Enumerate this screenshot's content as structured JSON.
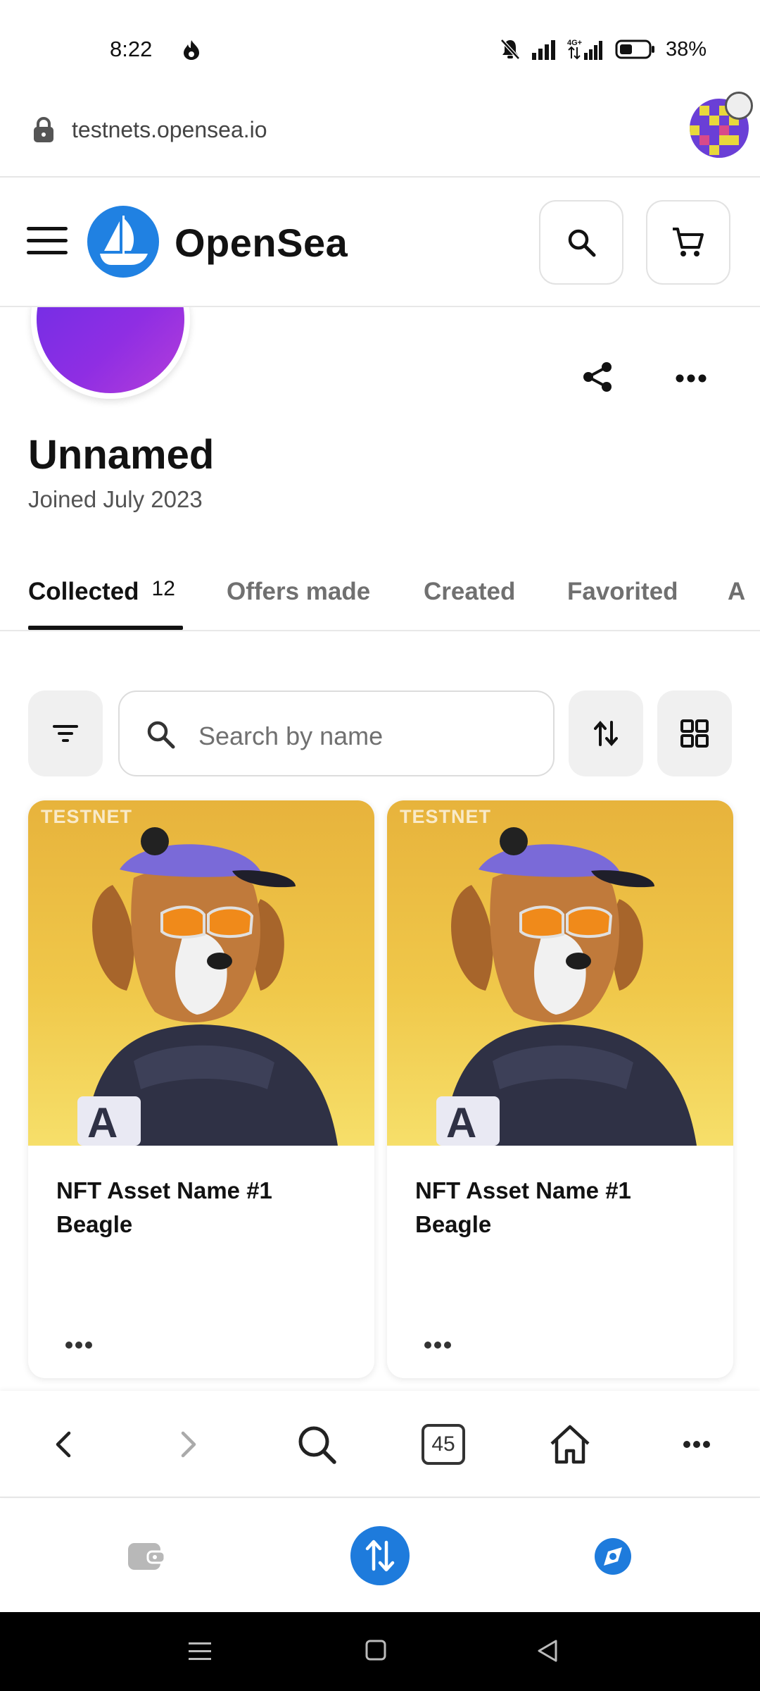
{
  "status_bar": {
    "time": "8:22",
    "battery": "38%"
  },
  "browser": {
    "url": "testnets.opensea.io",
    "tab_count": "45"
  },
  "header": {
    "brand": "OpenSea"
  },
  "profile": {
    "name": "Unnamed",
    "joined": "Joined July 2023"
  },
  "tabs": [
    {
      "label": "Collected",
      "count": "12"
    },
    {
      "label": "Offers made"
    },
    {
      "label": "Created"
    },
    {
      "label": "Favorited"
    },
    {
      "label": "A"
    }
  ],
  "search": {
    "placeholder": "Search by name"
  },
  "cards": [
    {
      "badge": "TESTNET",
      "name": "NFT Asset Name #1 Beagle"
    },
    {
      "badge": "TESTNET",
      "name": "NFT Asset Name #1 Beagle"
    }
  ],
  "icons": {
    "status": [
      "flame-icon",
      "mute-icon",
      "signal-icon",
      "4g-signal-icon",
      "battery-icon"
    ],
    "header": [
      "menu-icon",
      "opensea-logo-icon",
      "search-icon",
      "cart-icon"
    ],
    "browser_nav": [
      "back-icon",
      "forward-icon",
      "search-icon",
      "tabs-icon",
      "home-icon",
      "more-icon"
    ],
    "wallet": [
      "wallet-icon",
      "swap-icon",
      "explore-icon"
    ]
  },
  "colors": {
    "brand_blue": "#2081e2",
    "avatar_purple": "#8f2ee3",
    "card_yellow": "#f0c84a"
  }
}
